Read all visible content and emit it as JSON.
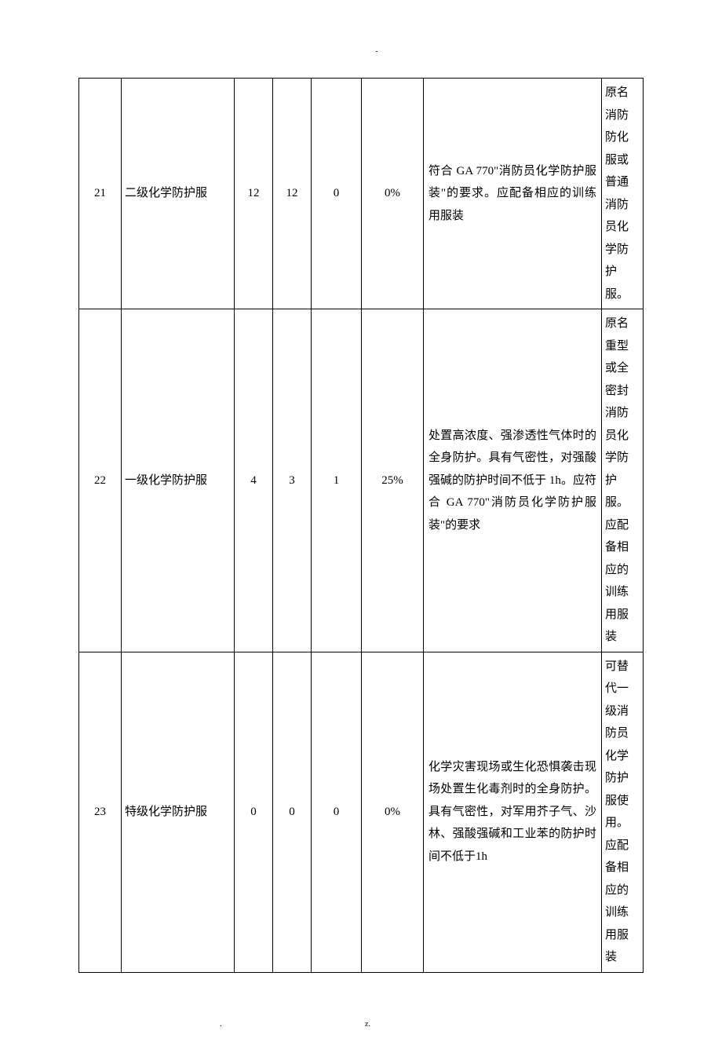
{
  "header_mark": "-",
  "footer_left": ".",
  "footer_right": "z.",
  "rows": [
    {
      "idx": "21",
      "name": "二级化学防护服",
      "n1": "12",
      "n2": "12",
      "n3": "0",
      "pct": "0%",
      "desc": "符合 GA 770\"消防员化学防护服装\"的要求。应配备相应的训练用服装",
      "note": "原名消防防化服或普通消防员化学防护服。"
    },
    {
      "idx": "22",
      "name": "一级化学防护服",
      "n1": "4",
      "n2": "3",
      "n3": "1",
      "pct": "25%",
      "desc": "处置高浓度、强渗透性气体时的全身防护。具有气密性，对强酸强碱的防护时间不低于 1h。应符合 GA 770\"消防员化学防护服装\"的要求",
      "note": "原名重型或全密封消防员化学防护服。应配备相应的训练用服装"
    },
    {
      "idx": "23",
      "name": "特级化学防护服",
      "n1": "0",
      "n2": "0",
      "n3": "0",
      "pct": "0%",
      "desc": "化学灾害现场或生化恐惧袭击现场处置生化毒剂时的全身防护。具有气密性，对军用芥子气、沙林、强酸强碱和工业苯的防护时间不低于1h",
      "note": "可替代一级消防员化学防护服使用。应配备相应的训练用服装"
    }
  ]
}
